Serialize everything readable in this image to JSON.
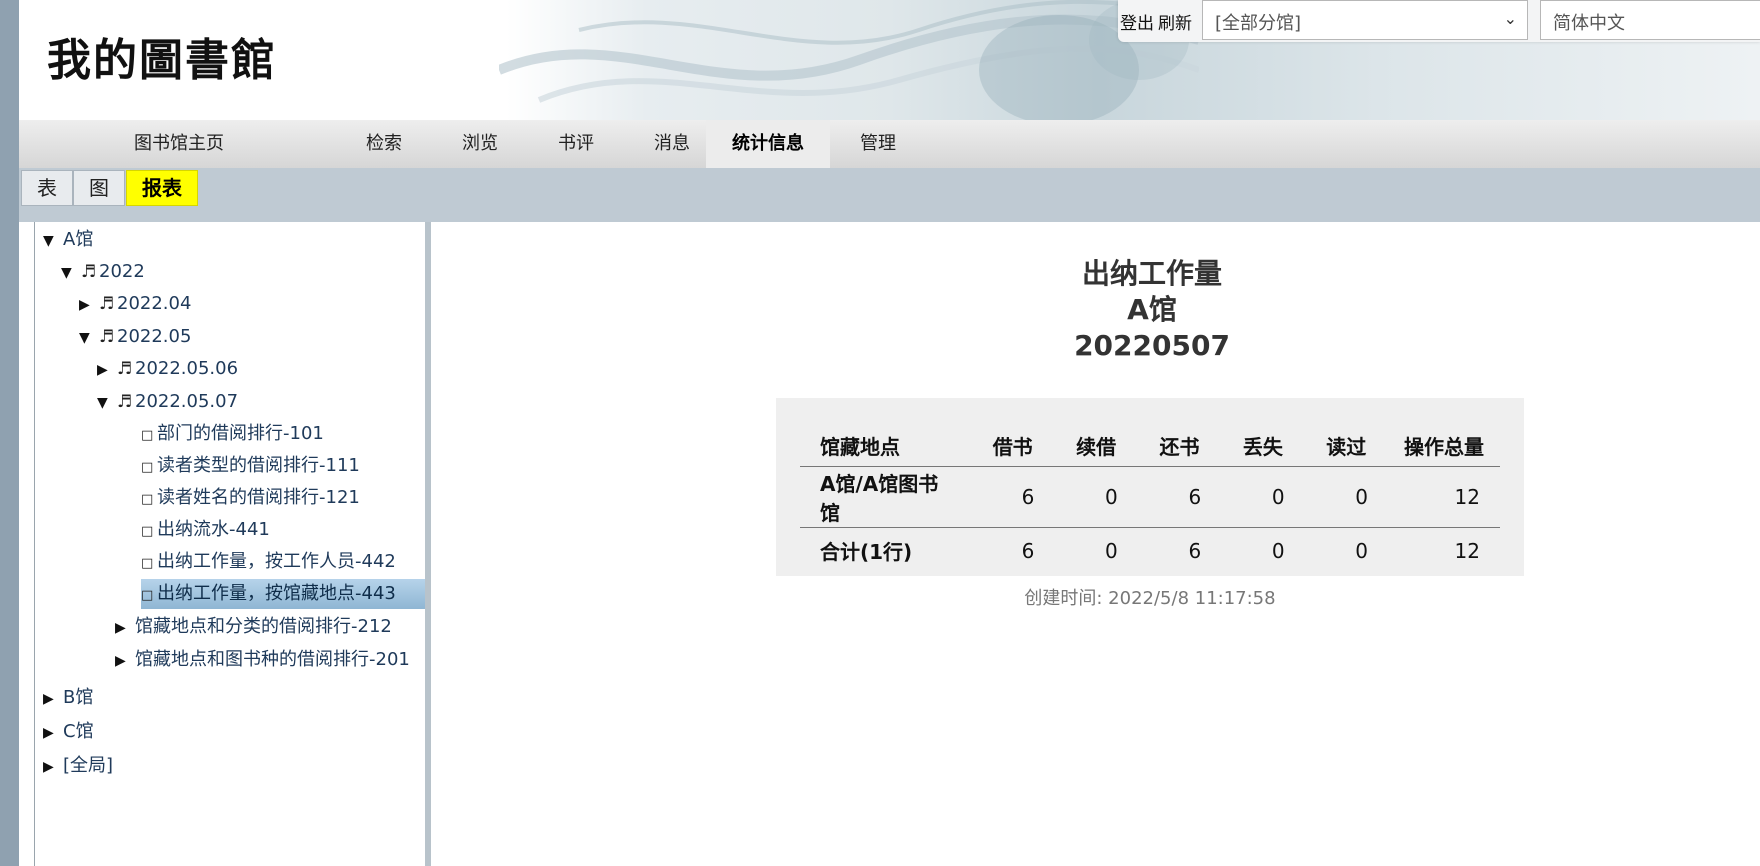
{
  "header": {
    "logo_text": "我的圖書館",
    "logout_label": "登出",
    "refresh_label": "刷新",
    "branch_select": {
      "value": "[全部分馆]"
    },
    "language_select": {
      "value": "简体中文"
    }
  },
  "nav": {
    "items": [
      {
        "label": "图书馆主页"
      },
      {
        "label": "检索"
      },
      {
        "label": "浏览"
      },
      {
        "label": "书评"
      },
      {
        "label": "消息"
      },
      {
        "label": "统计信息",
        "active": true
      },
      {
        "label": "管理"
      }
    ]
  },
  "subnav": {
    "tabs": [
      {
        "label": "表"
      },
      {
        "label": "图"
      },
      {
        "label": "报表",
        "active": true
      }
    ]
  },
  "tree": {
    "rows": [
      {
        "toggle": "▼",
        "label": "A馆"
      },
      {
        "toggle": "▼",
        "icon": "♬",
        "label": "2022"
      },
      {
        "toggle": "▶",
        "icon": "♬",
        "label": "2022.04"
      },
      {
        "toggle": "▼",
        "icon": "♬",
        "label": "2022.05"
      },
      {
        "toggle": "▶",
        "icon": "♬",
        "label": "2022.05.06"
      },
      {
        "toggle": "▼",
        "icon": "♬",
        "label": "2022.05.07"
      },
      {
        "box": "□",
        "label": "部门的借阅排行-101"
      },
      {
        "box": "□",
        "label": "读者类型的借阅排行-111"
      },
      {
        "box": "□",
        "label": "读者姓名的借阅排行-121"
      },
      {
        "box": "□",
        "label": "出纳流水-441"
      },
      {
        "box": "□",
        "label": "出纳工作量，按工作人员-442"
      },
      {
        "box": "□",
        "label": "出纳工作量，按馆藏地点-443",
        "selected": true
      },
      {
        "toggle": "▶",
        "label": "馆藏地点和分类的借阅排行-212"
      },
      {
        "toggle": "▶",
        "label": "馆藏地点和图书种的借阅排行-201"
      },
      {
        "toggle": "▶",
        "label": "B馆"
      },
      {
        "toggle": "▶",
        "label": "C馆"
      },
      {
        "toggle": "▶",
        "label": "[全局]"
      }
    ]
  },
  "report": {
    "title_lines": [
      "出纳工作量",
      "A馆",
      "20220507"
    ],
    "columns": [
      "馆藏地点",
      "借书",
      "续借",
      "还书",
      "丢失",
      "读过",
      "操作总量"
    ],
    "rows": [
      [
        "A馆/A馆图书馆",
        "6",
        "0",
        "6",
        "0",
        "0",
        "12"
      ],
      [
        "合计(1行)",
        "6",
        "0",
        "6",
        "0",
        "0",
        "12"
      ]
    ],
    "created": "创建时间: 2022/5/8 11:17:58"
  }
}
